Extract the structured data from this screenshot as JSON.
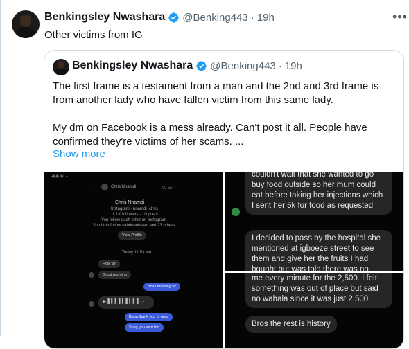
{
  "tweet": {
    "author_name": "Benkingsley Nwashara",
    "handle": "@Benking443",
    "separator": "·",
    "time": "19h",
    "text": "Other victims from IG",
    "more_icon": "more-icon"
  },
  "quote": {
    "author_name": "Benkingsley Nwashara",
    "handle": "@Benking443",
    "separator": "·",
    "time": "19h",
    "paragraph1": "The first frame is a testament from a man and the 2nd and 3rd frame is from another  lady who have fallen victim from this same lady.",
    "paragraph2": "My dm on Facebook is a mess already. Can't post it all. People have confirmed they're victims of her scams. ...",
    "show_more": "Show more"
  },
  "media": {
    "frame1": {
      "contact_name": "Chris Nnamdi",
      "sub1": "Instagram · nnamdi_chris",
      "sub2": "1.1K followers · 10 posts",
      "sub3": "You follow each other on Instagram",
      "sub4": "You both follow sabrinaobiaeri and 23 others",
      "view_profile": "View Profile",
      "time_label": "Today 11:53 am",
      "msg1": "How far",
      "msg2": "Good morning",
      "msg3": "Boss morning sir",
      "msg4": "Baba thank you o, omo",
      "msg5": "Shey you wan too"
    },
    "frame2": {
      "bubble1": "couldn't wait that she wanted to go buy food outside so her mum could eat before taking her injections which I sent her 5k for food as requested",
      "bubble2": "I decided to pass by the hospital she mentioned at igboeze street to see them and give her the fruits I had bought but was told there was no such person on admission"
    },
    "frame3": {
      "bubble1": "me every minute for the 2,500. I felt something was out of place but said no wahala since it was just 2,500",
      "bubble2": "Bros the rest is history"
    }
  },
  "colors": {
    "verified": "#1d9bf0",
    "link": "#1d9bf0",
    "muted": "#536471"
  }
}
